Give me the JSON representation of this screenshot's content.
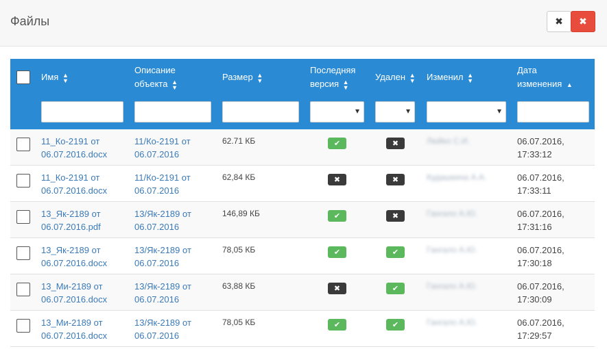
{
  "header": {
    "title": "Файлы",
    "minimize_icon": "✖",
    "close_icon": "✖"
  },
  "table": {
    "columns": {
      "name": "Имя",
      "desc_line1": "Описание",
      "desc_line2": "объекта",
      "size": "Размер",
      "last_line1": "Последняя",
      "last_line2": "версия",
      "deleted": "Удален",
      "changed_by": "Изменил",
      "date_line1": "Дата",
      "date_line2": "изменения"
    },
    "rows": [
      {
        "name1": "11_Ко-2191 от",
        "name2": "06.07.2016.docx",
        "desc1": "11/Ко-2191 от",
        "desc2": "06.07.2016",
        "size": "62.71 КБ",
        "last": true,
        "deleted": false,
        "user": "Люйко С.И.",
        "date1": "06.07.2016,",
        "date2": "17:33:12"
      },
      {
        "name1": "11_Ко-2191 от",
        "name2": "06.07.2016.docx",
        "desc1": "11/Ко-2191 от",
        "desc2": "06.07.2016",
        "size": "62,84 КБ",
        "last": false,
        "deleted": false,
        "user": "Кудашкина А.А.",
        "date1": "06.07.2016,",
        "date2": "17:33:11"
      },
      {
        "name1": "13_Як-2189 от",
        "name2": "06.07.2016.pdf",
        "desc1": "13/Як-2189 от",
        "desc2": "06.07.2016",
        "size": "146,89 КБ",
        "last": true,
        "deleted": false,
        "user": "Гангало А.Ю.",
        "date1": "06.07.2016,",
        "date2": "17:31:16"
      },
      {
        "name1": "13_Як-2189 от",
        "name2": "06.07.2016.docx",
        "desc1": "13/Як-2189 от",
        "desc2": "06.07.2016",
        "size": "78,05 КБ",
        "last": true,
        "deleted": true,
        "user": "Гангало А.Ю.",
        "date1": "06.07.2016,",
        "date2": "17:30:18"
      },
      {
        "name1": "13_Ми-2189 от",
        "name2": "06.07.2016.docx",
        "desc1": "13/Як-2189 от",
        "desc2": "06.07.2016",
        "size": "63,88 КБ",
        "last": false,
        "deleted": true,
        "user": "Гангало А.Ю.",
        "date1": "06.07.2016,",
        "date2": "17:30:09"
      },
      {
        "name1": "13_Ми-2189 от",
        "name2": "06.07.2016.docx",
        "desc1": "13/Як-2189 от",
        "desc2": "06.07.2016",
        "size": "78,05 КБ",
        "last": true,
        "deleted": true,
        "user": "Гангало А.Ю.",
        "date1": "06.07.2016,",
        "date2": "17:29:57"
      }
    ]
  },
  "icons": {
    "check": "✔",
    "cross": "✖",
    "sort_up": "▲",
    "sort_down": "▼",
    "sort_asc": "▲",
    "dropdown": "▾"
  },
  "colors": {
    "header_blue": "#2a8ad3",
    "link": "#3a7ab8",
    "badge_yes": "#5cb85c",
    "badge_no": "#3a3a3a",
    "close_red": "#e74c3c"
  }
}
